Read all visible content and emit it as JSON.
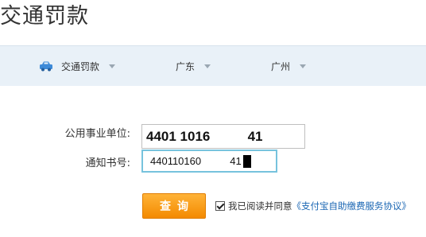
{
  "header": {
    "title": "交通罚款"
  },
  "nav": {
    "category": {
      "label": "交通罚款",
      "icon": "car-icon"
    },
    "province": {
      "label": "广东"
    },
    "city": {
      "label": "广州"
    }
  },
  "form": {
    "org_label": "公用事业单位:",
    "org_value": "4401 1016          41",
    "notice_label": "通知书号:",
    "notice_value": "440110160          41",
    "query_label": "查询",
    "agree_text": "我已阅读并同意",
    "agreement_link": "《支付宝自助缴费服务协议》"
  },
  "colors": {
    "nav_background": "#e9f1f8",
    "button_orange": "#f59a12",
    "link_blue": "#1a66b3",
    "focus_border": "#77c3dd"
  }
}
